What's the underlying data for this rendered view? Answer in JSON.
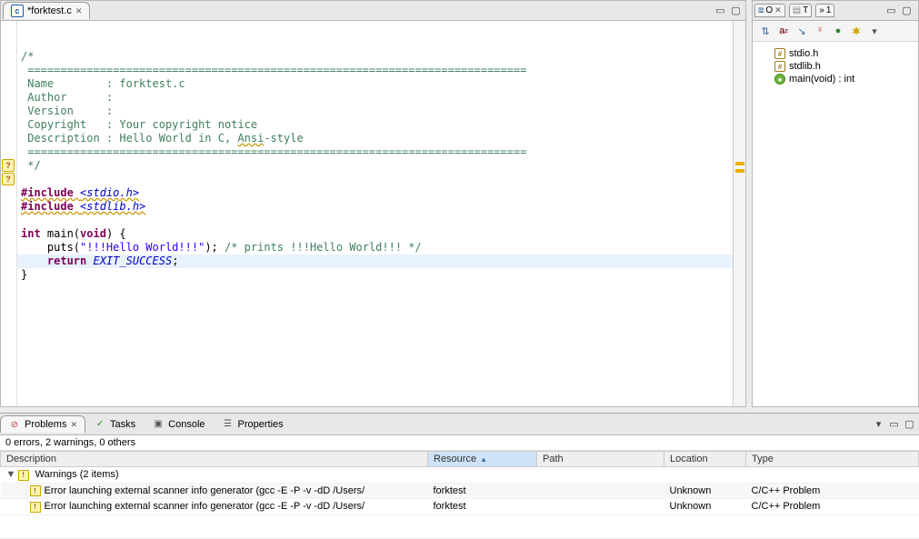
{
  "editor": {
    "tab": {
      "label": "*forktest.c"
    },
    "code": {
      "comment_open": "/*",
      "divider": " ============================================================================",
      "name_line": " Name        : forktest.c",
      "author_line": " Author      :",
      "version_line": " Version     :",
      "copyright_line": " Copyright   : Your copyright notice",
      "description_line": " Description : Hello World in C, ",
      "description_ansi": "Ansi",
      "description_tail": "-style",
      "comment_close": " */",
      "include1_kw": "#include ",
      "include1_hdr": "<stdio.h>",
      "include2_kw": "#include ",
      "include2_hdr": "<stdlib.h>",
      "main_sig_kw1": "int",
      "main_sig_mid": " main(",
      "main_sig_kw2": "void",
      "main_sig_tail": ") {",
      "puts_indent": "    puts(",
      "puts_str": "\"!!!Hello World!!!\"",
      "puts_tail": "); ",
      "puts_comment": "/* prints !!!Hello World!!! */",
      "return_indent": "    ",
      "return_kw": "return",
      "return_mid": " ",
      "return_macro": "EXIT_SUCCESS",
      "return_tail": ";",
      "brace_close": "}"
    }
  },
  "outline": {
    "tabs": {
      "t1": "O",
      "t2": "T",
      "t3": "1"
    },
    "items": [
      {
        "label": "stdio.h",
        "kind": "include"
      },
      {
        "label": "stdlib.h",
        "kind": "include"
      },
      {
        "label": "main(void) : int",
        "kind": "func"
      }
    ]
  },
  "bottom": {
    "tabs": {
      "problems": "Problems",
      "tasks": "Tasks",
      "console": "Console",
      "properties": "Properties"
    },
    "summary": "0 errors, 2 warnings, 0 others",
    "columns": {
      "description": "Description",
      "resource": "Resource",
      "path": "Path",
      "location": "Location",
      "type": "Type"
    },
    "group_label": "Warnings (2 items)",
    "rows": [
      {
        "description": "Error launching external scanner info generator (gcc -E -P -v -dD /Users/",
        "resource": "forktest",
        "path": "",
        "location": "Unknown",
        "type": "C/C++ Problem"
      },
      {
        "description": "Error launching external scanner info generator (gcc -E -P -v -dD /Users/",
        "resource": "forktest",
        "path": "",
        "location": "Unknown",
        "type": "C/C++ Problem"
      }
    ]
  }
}
